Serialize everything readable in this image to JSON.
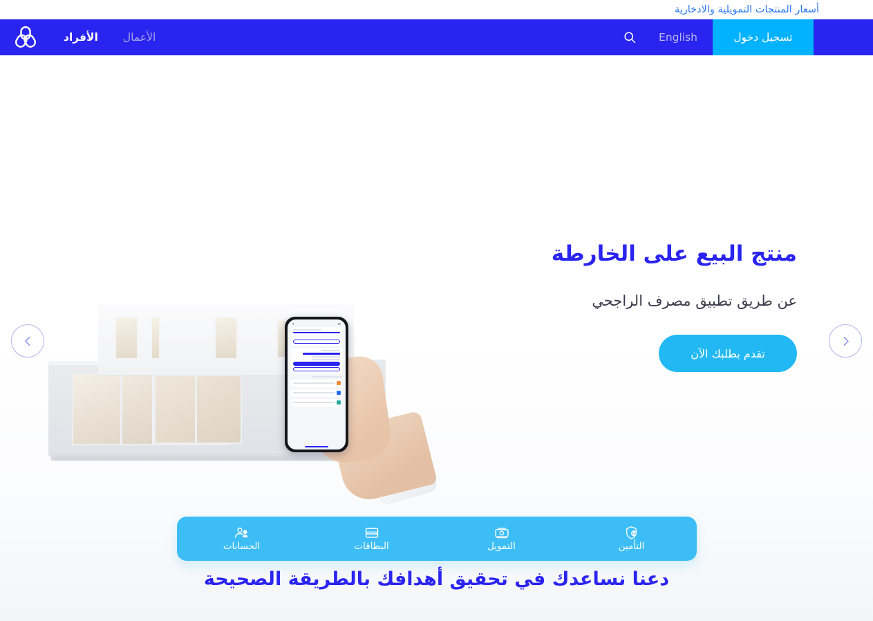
{
  "topbar": {
    "link_label": "أسعار المنتجات التمويلية والادخارية",
    "link_color": "#2e7bf6"
  },
  "navbar": {
    "background_color": "#2a24f0",
    "login_label": "تسجيل دخول",
    "login_color": "#00b2ff",
    "language_label": "English",
    "search_icon": "search-icon",
    "brand_logo_icon": "alrajhi-logo-icon",
    "tabs": [
      {
        "label": "الأفراد",
        "active": true
      },
      {
        "label": "الأعمال",
        "active": false
      }
    ]
  },
  "hero": {
    "title": "منتج البيع على الخارطة",
    "subtitle": "عن طريق تطبيق مصرف الراجحي",
    "cta_label": "تقدم بطلبك الآن",
    "cta_color": "#22b8f4",
    "title_color": "#2a24f0",
    "prev_icon": "chevron-left-icon",
    "next_icon": "chevron-right-icon",
    "slide_count": 5,
    "active_slide": 1,
    "art_alt": "منزل حديث مع يد تحمل هاتفاً يعرض تطبيق مصرف الراجحي"
  },
  "quick_links": {
    "background_color": "#3dbdf5",
    "items": [
      {
        "label": "التأمين",
        "icon": "shield-person-icon"
      },
      {
        "label": "التمويل",
        "icon": "banknotes-icon"
      },
      {
        "label": "البطاقات",
        "icon": "credit-card-icon"
      },
      {
        "label": "الحسابات",
        "icon": "users-icon"
      }
    ]
  },
  "band": {
    "headline": "دعنا نساعدك في تحقيق أهدافك بالطريقة الصحيحة"
  }
}
